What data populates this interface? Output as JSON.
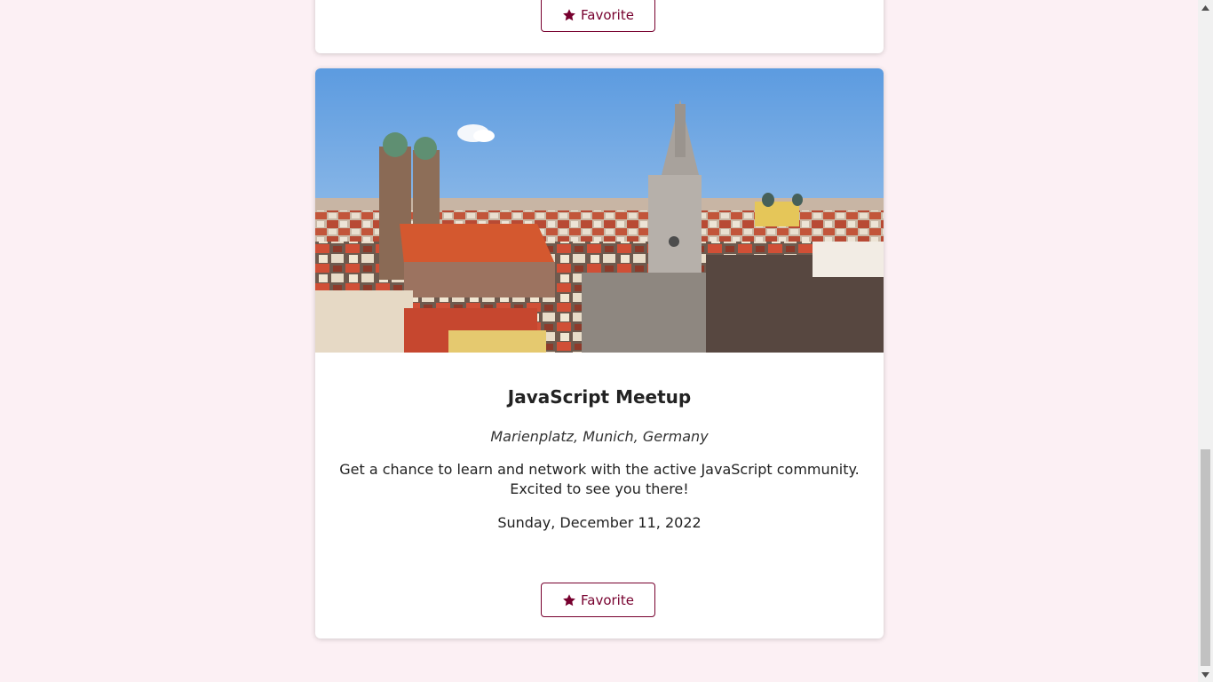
{
  "colors": {
    "page_background": "#fcf0f4",
    "accent": "#77002e",
    "card_background": "#ffffff"
  },
  "previous_card": {
    "favorite_label": "Favorite",
    "favorite_icon": "star-icon"
  },
  "meetup": {
    "image_alt": "Munich skyline with Frauenkirche and New Town Hall",
    "title": "JavaScript Meetup",
    "address": "Marienplatz, Munich, Germany",
    "description": "Get a chance to learn and network with the active JavaScript community. Excited to see you there!",
    "date": "Sunday, December 11, 2022",
    "favorite_label": "Favorite",
    "favorite_icon": "star-icon"
  }
}
